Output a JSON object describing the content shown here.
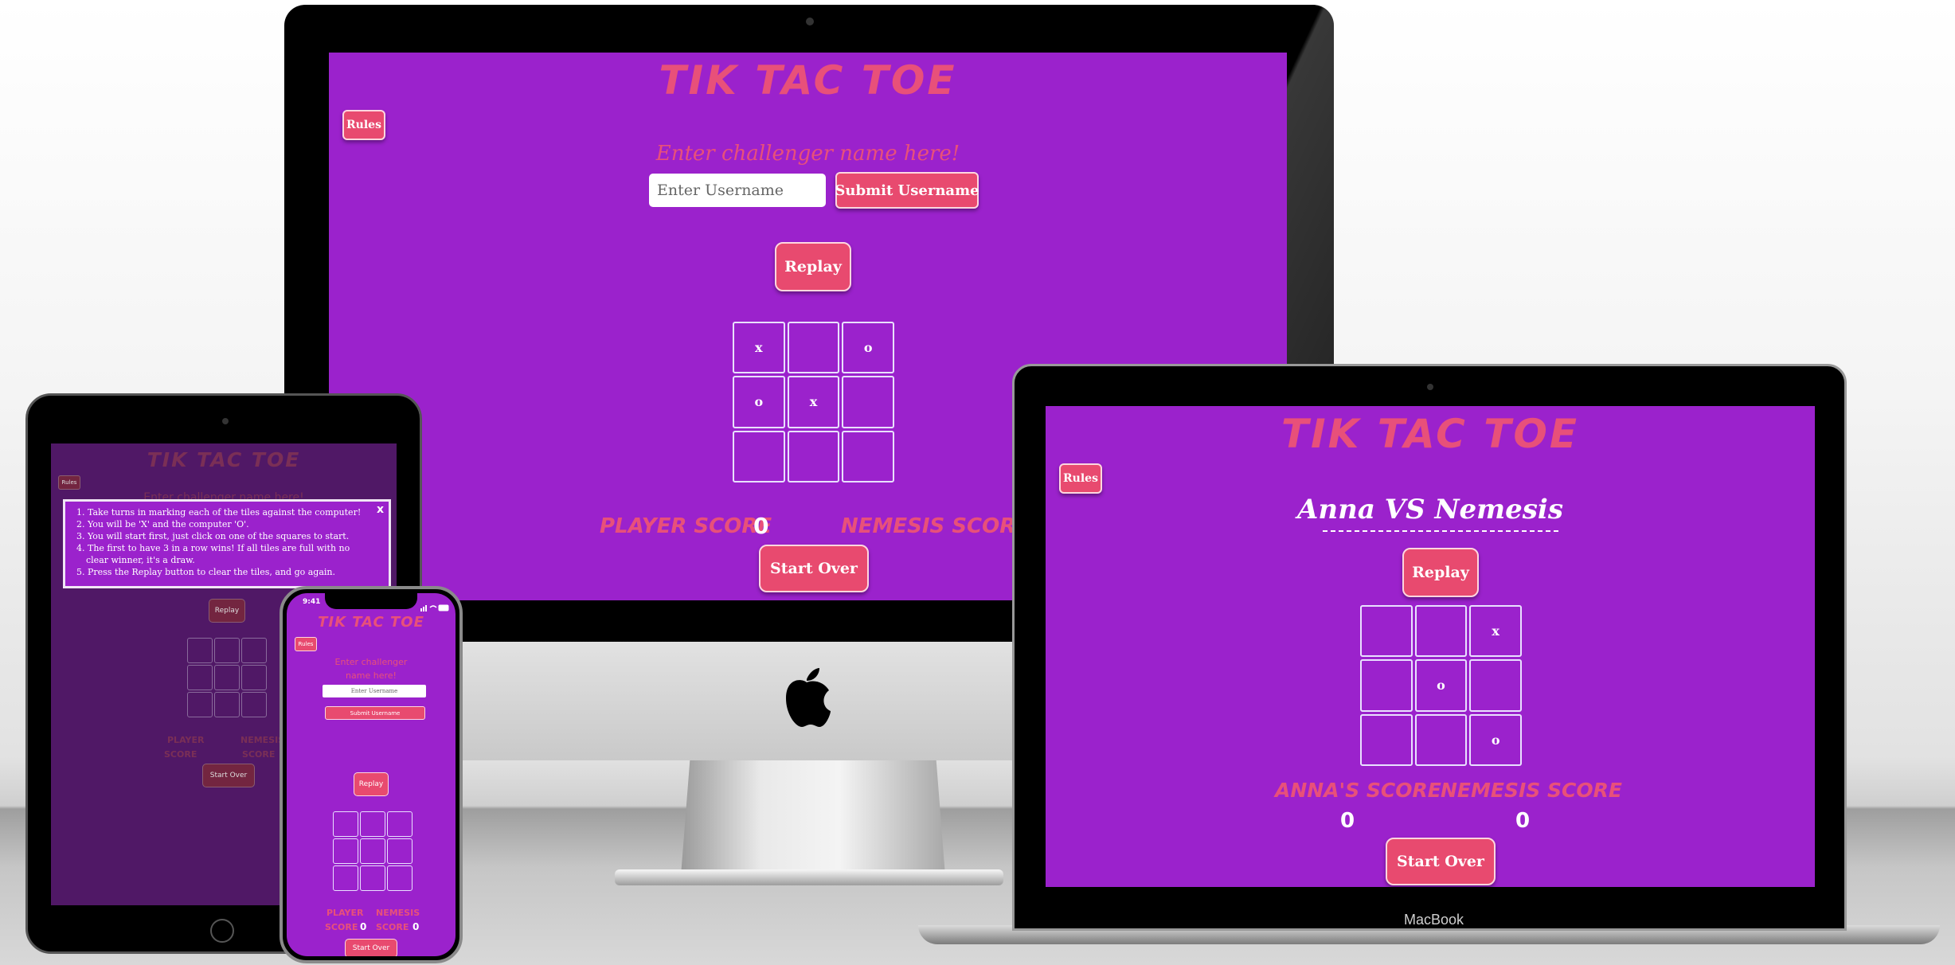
{
  "game": {
    "title": "TIK TAC TOE",
    "rules_label": "Rules",
    "replay_label": "Replay",
    "start_over_label": "Start Over"
  },
  "imac": {
    "prompt": "Enter challenger name here!",
    "username_placeholder": "Enter Username",
    "submit_label": "Submit Username",
    "board": [
      "x",
      "",
      "o",
      "o",
      "x",
      "",
      "",
      "",
      ""
    ],
    "player_score_label": "PLAYER SCORE",
    "player_score_value": "0",
    "nemesis_score_label": "NEMESIS SCORE"
  },
  "macbook": {
    "versus": "Anna VS Nemesis",
    "board": [
      "",
      "",
      "x",
      "",
      "o",
      "",
      "",
      "",
      "o"
    ],
    "player_score_label": "ANNA'S SCORE",
    "player_score_value": "0",
    "nemesis_score_label": "NEMESIS SCORE",
    "nemesis_score_value": "0",
    "brand": "MacBook"
  },
  "ipad": {
    "prompt": "Enter challenger name here!",
    "rules_items": [
      "1. Take turns in marking each of the tiles against the computer!",
      "2. You will be 'X' and the computer 'O'.",
      "3. You will start first, just click on one of the squares to start.",
      "4. The first to have 3 in a row wins! If all tiles are full with no",
      "clear winner, it's a draw.",
      "5. Press the Replay button to clear the tiles, and go again."
    ],
    "close_label": "x",
    "player_score_label_1": "PLAYER",
    "player_score_label_2": "SCORE",
    "nemesis_score_label_1": "NEMESIS",
    "nemesis_score_label_2": "SCORE"
  },
  "iphone": {
    "time": "9:41",
    "prompt_line1": "Enter challenger",
    "prompt_line2": "name here!",
    "username_placeholder": "Enter Username",
    "submit_label": "Submit Username",
    "player_score_label_1": "PLAYER",
    "player_score_label_2": "SCORE",
    "player_score_value": "0",
    "nemesis_score_label_1": "NEMESIS",
    "nemesis_score_label_2": "SCORE",
    "nemesis_score_value": "0"
  },
  "colors": {
    "screen_bg": "#9b22cc",
    "accent": "#e8507a",
    "button": "#e84a6f"
  }
}
